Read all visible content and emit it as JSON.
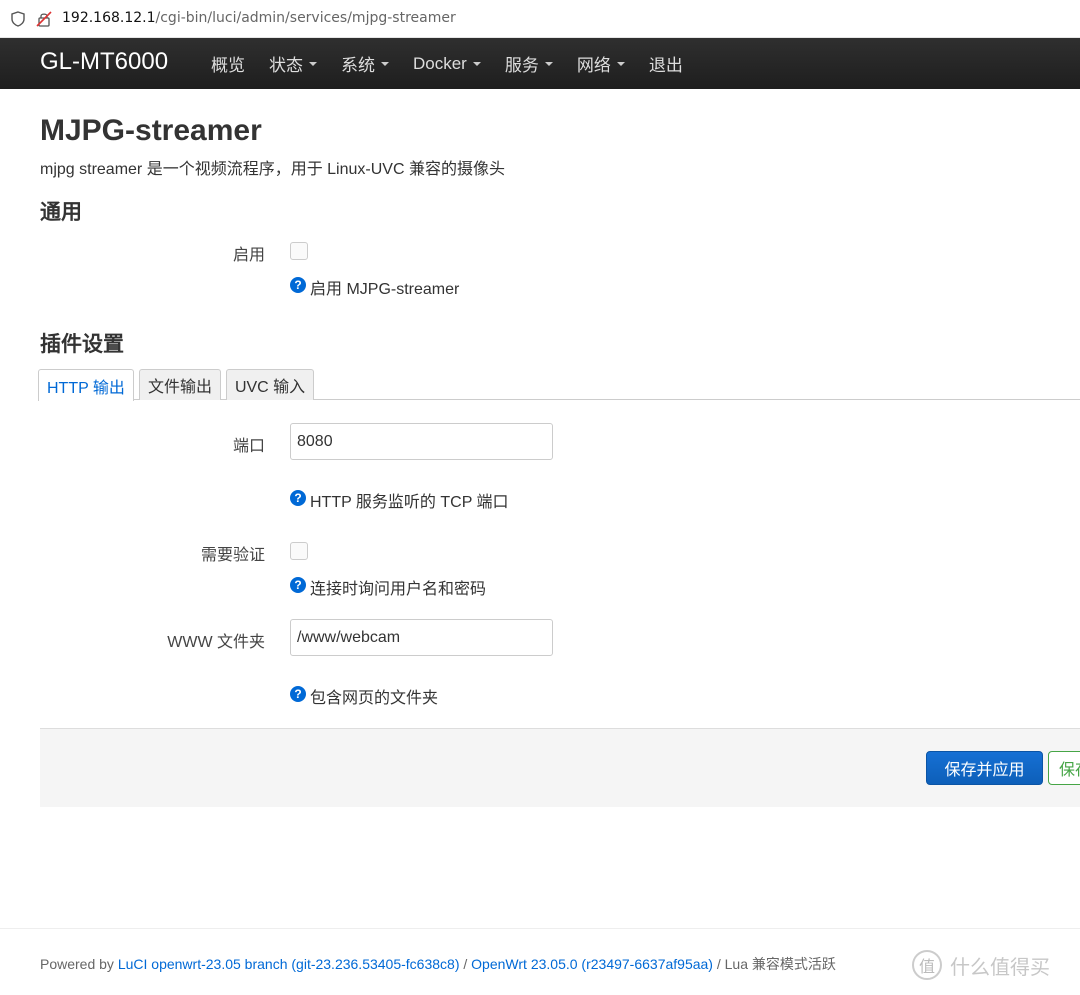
{
  "browser": {
    "url_host": "192.168.12.1",
    "url_path": "/cgi-bin/luci/admin/services/mjpg-streamer"
  },
  "navbar": {
    "brand": "GL-MT6000",
    "items": [
      {
        "label": "概览",
        "dropdown": false
      },
      {
        "label": "状态",
        "dropdown": true
      },
      {
        "label": "系统",
        "dropdown": true
      },
      {
        "label": "Docker",
        "dropdown": true
      },
      {
        "label": "服务",
        "dropdown": true
      },
      {
        "label": "网络",
        "dropdown": true
      },
      {
        "label": "退出",
        "dropdown": false
      }
    ]
  },
  "page": {
    "title": "MJPG-streamer",
    "description": "mjpg streamer 是一个视频流程序，用于 Linux-UVC 兼容的摄像头"
  },
  "general": {
    "title": "通用",
    "enable_label": "启用",
    "enable_checked": false,
    "enable_help": "启用 MJPG-streamer"
  },
  "plugins": {
    "title": "插件设置",
    "tabs": [
      {
        "label": "HTTP 输出",
        "active": true
      },
      {
        "label": "文件输出",
        "active": false
      },
      {
        "label": "UVC 输入",
        "active": false
      }
    ],
    "port_label": "端口",
    "port_value": "8080",
    "port_help": "HTTP 服务监听的 TCP 端口",
    "auth_label": "需要验证",
    "auth_checked": false,
    "auth_help": "连接时询问用户名和密码",
    "www_label": "WWW 文件夹",
    "www_value": "/www/webcam",
    "www_help": "包含网页的文件夹"
  },
  "actions": {
    "save_apply": "保存并应用",
    "save": "保存"
  },
  "footer": {
    "powered_by": "Powered by ",
    "luci_link": "LuCI openwrt-23.05 branch (git-23.236.53405-fc638c8)",
    "sep1": " / ",
    "openwrt_link": "OpenWrt 23.05.0 (r23497-6637af95aa)",
    "sep2": " / Lua 兼容模式活跃"
  },
  "watermark": {
    "glyph": "值",
    "text": "什么值得买"
  },
  "colors": {
    "navbar_bg": "#222222",
    "link": "#0069d6",
    "primary_button": "#0d5fb9",
    "save_button": "#46a546"
  }
}
